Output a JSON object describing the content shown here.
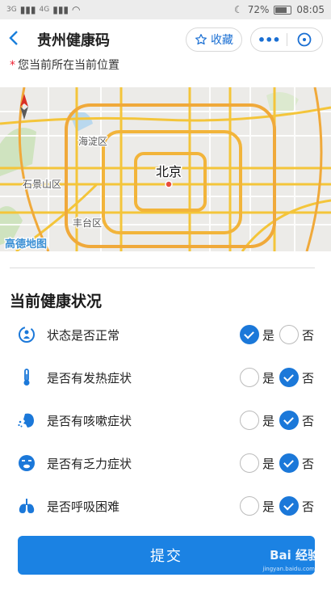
{
  "status_bar": {
    "signal_left": "3G",
    "signal_right": "4G",
    "battery": "72%",
    "time": "08:05"
  },
  "nav": {
    "title": "贵州健康码",
    "favorite_label": "收藏",
    "more_label": "•••"
  },
  "location_note": "您当前所在当前位置",
  "map": {
    "city_label": "北京",
    "district_labels": [
      "海淀区",
      "石景山区",
      "丰台区"
    ],
    "attribution": "高德地图"
  },
  "health": {
    "section_title": "当前健康状况",
    "yes_label": "是",
    "no_label": "否",
    "items": [
      {
        "label": "状态是否正常",
        "icon": "person-refresh-icon",
        "selected": "yes"
      },
      {
        "label": "是否有发热症状",
        "icon": "thermometer-icon",
        "selected": "no"
      },
      {
        "label": "是否有咳嗽症状",
        "icon": "cough-icon",
        "selected": "no"
      },
      {
        "label": "是否有乏力症状",
        "icon": "tired-face-icon",
        "selected": "no"
      },
      {
        "label": "是否呼吸困难",
        "icon": "lungs-icon",
        "selected": "no"
      }
    ]
  },
  "submit_label": "提交",
  "watermark": {
    "brand": "Bai 经验",
    "url": "jingyan.baidu.com"
  },
  "colors": {
    "accent": "#1b78d9",
    "button": "#1b82e3"
  }
}
